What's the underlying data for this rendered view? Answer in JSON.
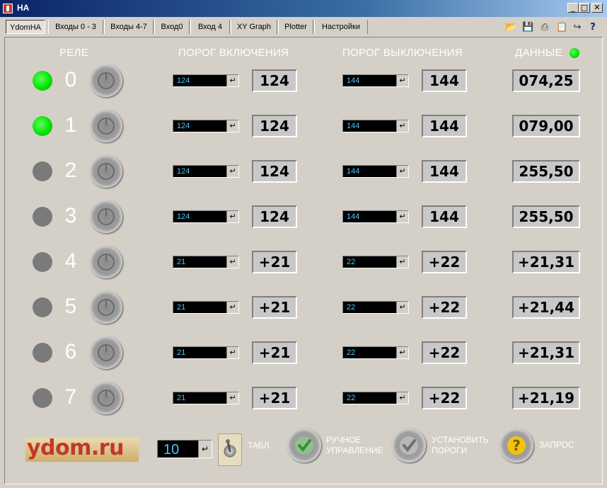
{
  "window": {
    "title": "HA",
    "controls": {
      "minimize": "_",
      "maximize": "□",
      "close": "✕"
    }
  },
  "tabs": [
    "YdomHA",
    "Входы 0 - 3",
    "Входы 4-7",
    "Вход0",
    "Вход 4",
    "XY Graph",
    "Plotter",
    "Настройки"
  ],
  "active_tab": "YdomHA",
  "toolbar_icons": [
    "open-folder-icon",
    "save-icon",
    "print-icon",
    "clipboard-icon",
    "link-icon",
    "help-icon"
  ],
  "headers": {
    "relay": "РЕЛЕ",
    "on_threshold": "ПОРОГ ВКЛЮЧЕНИЯ",
    "off_threshold": "ПОРОГ ВЫКЛЮЧЕНИЯ",
    "data": "ДАННЫЕ"
  },
  "data_indicator_color": "#00e000",
  "relays": [
    {
      "num": "0",
      "state": "on",
      "on_input": "124",
      "on_value": "124",
      "off_input": "144",
      "off_value": "144",
      "data": "074,25"
    },
    {
      "num": "1",
      "state": "on",
      "on_input": "124",
      "on_value": "124",
      "off_input": "144",
      "off_value": "144",
      "data": "079,00"
    },
    {
      "num": "2",
      "state": "off",
      "on_input": "124",
      "on_value": "124",
      "off_input": "144",
      "off_value": "144",
      "data": "255,50"
    },
    {
      "num": "3",
      "state": "off",
      "on_input": "124",
      "on_value": "124",
      "off_input": "144",
      "off_value": "144",
      "data": "255,50"
    },
    {
      "num": "4",
      "state": "off",
      "on_input": "21",
      "on_value": "+21",
      "off_input": "22",
      "off_value": "+22",
      "data": "+21,31"
    },
    {
      "num": "5",
      "state": "off",
      "on_input": "21",
      "on_value": "+21",
      "off_input": "22",
      "off_value": "+22",
      "data": "+21,44"
    },
    {
      "num": "6",
      "state": "off",
      "on_input": "21",
      "on_value": "+21",
      "off_input": "22",
      "off_value": "+22",
      "data": "+21,31"
    },
    {
      "num": "7",
      "state": "off",
      "on_input": "21",
      "on_value": "+21",
      "off_input": "22",
      "off_value": "+22",
      "data": "+21,19"
    }
  ],
  "bottom": {
    "logo": "ydom.ru",
    "interval_value": "10",
    "table_label": "ТАБЛ.",
    "manual": {
      "line1": "РУЧНОЕ",
      "line2": "УПРАВЛЕНИЕ"
    },
    "set_thresholds": {
      "line1": "УСТАНОВИТЬ",
      "line2": "ПОРОГИ"
    },
    "request": "ЗАПРОС"
  },
  "colors": {
    "led_on": "#00e000",
    "led_off": "#7a7a7a",
    "spin_text": "#4fc3f7",
    "panel_bg": "#d4d0c8"
  }
}
